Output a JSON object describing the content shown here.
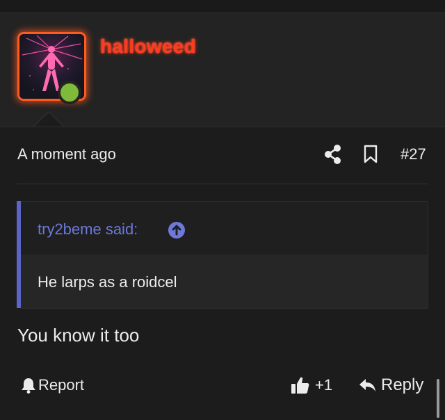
{
  "post": {
    "username": "halloweed",
    "user_online": true,
    "avatar_icon": "glowing-figure-avatar",
    "timestamp": "A moment ago",
    "post_number": "#27",
    "body": "You know it too"
  },
  "quote": {
    "author_label": "try2beme said:",
    "text": "He larps as a roidcel",
    "accent_color": "#5c64c8"
  },
  "actions": {
    "report_label": "Report",
    "like_count": "+1",
    "reply_label": "Reply"
  },
  "colors": {
    "username": "#ff3b1f",
    "online": "#7fba3a",
    "background": "#1c1c1c"
  }
}
